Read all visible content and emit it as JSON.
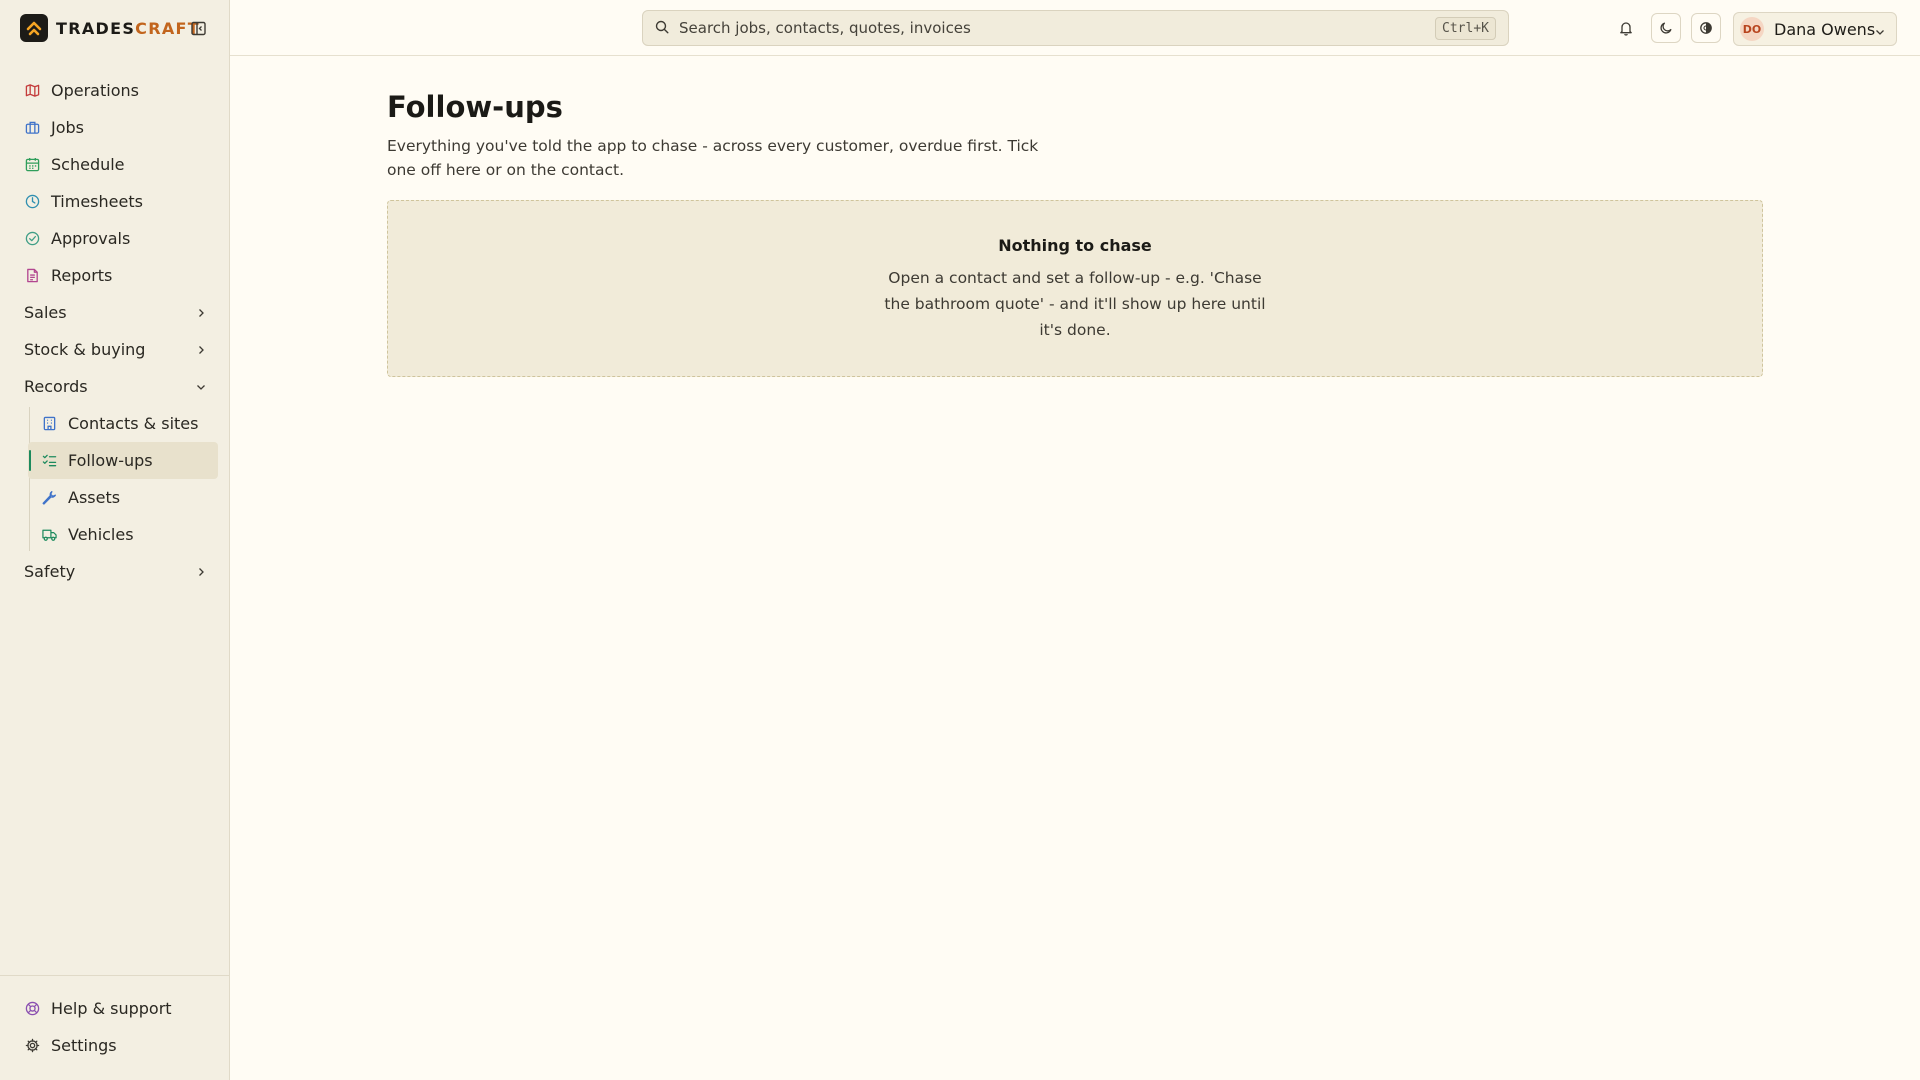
{
  "brand": {
    "name_main": "TRADES",
    "name_accent": "CRAFT"
  },
  "sidebar": {
    "items": [
      {
        "label": "Operations",
        "icon": "map-icon",
        "color": "#c43c3c"
      },
      {
        "label": "Jobs",
        "icon": "briefcase-icon",
        "color": "#3f73c9"
      },
      {
        "label": "Schedule",
        "icon": "calendar-icon",
        "color": "#2f9e5b"
      },
      {
        "label": "Timesheets",
        "icon": "clock-icon",
        "color": "#2f8fb0"
      },
      {
        "label": "Approvals",
        "icon": "check-circle-icon",
        "color": "#3f9e86"
      },
      {
        "label": "Reports",
        "icon": "document-icon",
        "color": "#b2458f"
      }
    ],
    "groups": {
      "sales": "Sales",
      "stock": "Stock & buying",
      "records": "Records",
      "safety": "Safety"
    },
    "records_items": [
      {
        "label": "Contacts & sites",
        "icon": "building-icon",
        "color": "#3f73c9"
      },
      {
        "label": "Follow-ups",
        "icon": "list-check-icon",
        "color": "#1c8a5d",
        "active": true
      },
      {
        "label": "Assets",
        "icon": "wrench-icon",
        "color": "#3f73c9"
      },
      {
        "label": "Vehicles",
        "icon": "truck-icon",
        "color": "#1c8a5d"
      }
    ],
    "bottom": [
      {
        "label": "Help & support",
        "icon": "lifebuoy-icon",
        "color": "#8a4fb0"
      },
      {
        "label": "Settings",
        "icon": "gear-icon",
        "color": "#3d3a33"
      }
    ]
  },
  "header": {
    "search_placeholder": "Search jobs, contacts, quotes, invoices",
    "search_shortcut": "Ctrl+K",
    "user": {
      "initials": "DO",
      "name": "Dana Owens"
    }
  },
  "main": {
    "title": "Follow-ups",
    "description": "Everything you've told the app to chase - across every customer, overdue first. Tick one off here or on the contact.",
    "empty_title": "Nothing to chase",
    "empty_text": "Open a contact and set a follow-up - e.g. 'Chase the bathroom quote' - and it'll show up here until it's done."
  }
}
